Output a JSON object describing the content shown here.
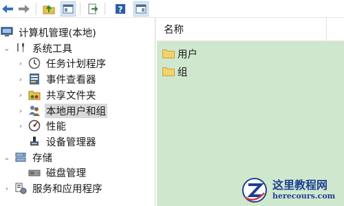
{
  "toolbar": {
    "buttons": [
      "back-arrow",
      "forward-arrow",
      "up-folder",
      "show-hide-console-tree",
      "export-list",
      "help",
      "show-hide-action-pane"
    ]
  },
  "tree": {
    "root": "计算机管理(本地)",
    "system_tools": "系统工具",
    "task_scheduler": "任务计划程序",
    "event_viewer": "事件查看器",
    "shared_folders": "共享文件夹",
    "local_users_groups": "本地用户和组",
    "performance": "性能",
    "device_manager": "设备管理器",
    "storage": "存储",
    "disk_management": "磁盘管理",
    "services_apps": "服务和应用程序"
  },
  "list": {
    "column_name": "名称",
    "items": [
      "用户",
      "组"
    ]
  },
  "watermark": {
    "title": "这里教程网",
    "url": "herecours.com"
  },
  "colors": {
    "list_background": "#cfe8cd",
    "selected_row": "#d9d9d9",
    "watermark_blue": "#1d3f94"
  }
}
